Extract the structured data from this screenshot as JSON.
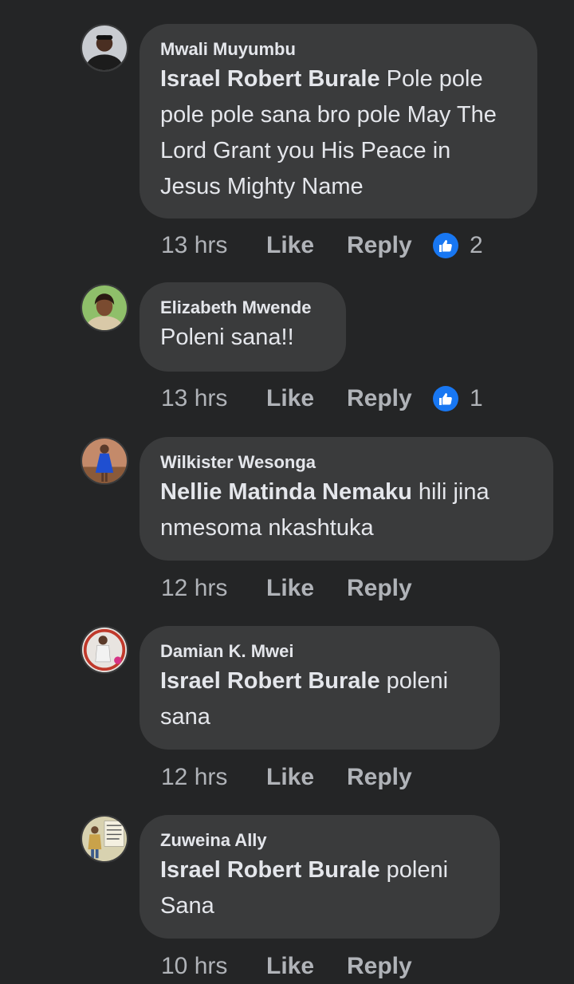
{
  "comments": [
    {
      "author": "Mwali Muyumbu",
      "tag": "Israel Robert Burale",
      "text": " Pole pole pole pole sana bro pole May The Lord Grant you His Peace in Jesus Mighty Name",
      "time": "13 hrs",
      "like_label": "Like",
      "reply_label": "Reply",
      "reactions": "2",
      "avatar_colors": {
        "bg": "#c9ccd1",
        "skin": "#4a2f22",
        "shirt": "#1c1c1c"
      }
    },
    {
      "author": "Elizabeth Mwende",
      "tag": "",
      "text": "Poleni sana!!",
      "time": "13 hrs",
      "like_label": "Like",
      "reply_label": "Reply",
      "reactions": "1",
      "avatar_colors": {
        "bg": "#8fbf6a",
        "skin": "#7a4b30",
        "shirt": "#d9c9a8"
      }
    },
    {
      "author": "Wilkister Wesonga",
      "tag": "Nellie Matinda Nemaku",
      "text": " hili jina nmesoma nkashtuka",
      "time": "12 hrs",
      "like_label": "Like",
      "reply_label": "Reply",
      "reactions": "",
      "avatar_colors": {
        "bg": "#c48a6a",
        "skin": "#5a3a2a",
        "shirt": "#1f4fd1"
      }
    },
    {
      "author": "Damian K. Mwei",
      "tag": "Israel Robert Burale",
      "text": " poleni sana",
      "time": "12 hrs",
      "like_label": "Like",
      "reply_label": "Reply",
      "reactions": "",
      "avatar_colors": {
        "bg": "#e8e4e0",
        "skin": "#5a3a2a",
        "shirt": "#f2f2f2"
      }
    },
    {
      "author": "Zuweina Ally",
      "tag": "Israel Robert Burale",
      "text": " poleni Sana",
      "time": "10 hrs",
      "like_label": "Like",
      "reply_label": "Reply",
      "reactions": "",
      "avatar_colors": {
        "bg": "#d8d2b0",
        "skin": "#6a4a30",
        "shirt": "#c9a24a"
      }
    }
  ],
  "icons": {
    "reaction": "thumbs-up-icon"
  },
  "colors": {
    "background": "#242526",
    "bubble": "#3a3b3c",
    "meta": "#b0b3b8",
    "reaction_blue": "#1877f2"
  }
}
